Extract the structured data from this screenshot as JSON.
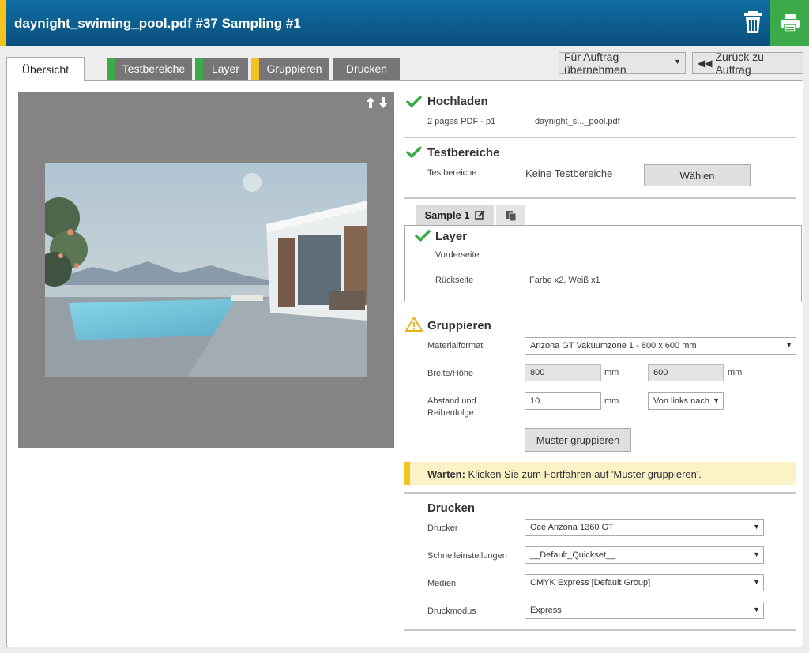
{
  "header": {
    "title": "daynight_swiming_pool.pdf #37 Sampling #1",
    "accent_color": "#f5c31b",
    "bar_color": "#0a5a8c",
    "print_color": "#3bab4a"
  },
  "tabs": [
    {
      "label": "Übersicht",
      "status": "active"
    },
    {
      "label": "Testbereiche",
      "status": "ok"
    },
    {
      "label": "Layer",
      "status": "ok"
    },
    {
      "label": "Gruppieren",
      "status": "warning"
    },
    {
      "label": "Drucken",
      "status": "none"
    }
  ],
  "toolbar": {
    "take_over_label": "Für Auftrag übernehmen",
    "back_label": "Zurück zu Auftrag"
  },
  "preview": {
    "arrows": "🡅🡇"
  },
  "upload": {
    "title": "Hochladen",
    "pages": "2 pages PDF - p1",
    "filename": "daynight_s..._pool.pdf"
  },
  "testareas": {
    "title": "Testbereiche",
    "label": "Testbereiche",
    "value": "Keine Testbereiche",
    "choose_label": "Wählen"
  },
  "sample": {
    "tab_label": "Sample 1",
    "layer_title": "Layer",
    "front_label": "Vorderseite",
    "back_label": "Rückseite",
    "back_value": "Farbe x2, Weiß x1"
  },
  "group": {
    "title": "Gruppieren",
    "material_label": "Materialformat",
    "material_value": "Arizona GT Vakuumzone 1 - 800 x 600 mm",
    "size_label": "Breite/Höhe",
    "width": "800",
    "height": "600",
    "unit": "mm",
    "spacing_label_1": "Abstand und",
    "spacing_label_2": "Reihenfolge",
    "spacing": "10",
    "order_value": "Von links nach",
    "group_button": "Muster gruppieren"
  },
  "warning": {
    "strong": "Warten:",
    "text": "Klicken Sie zum Fortfahren auf 'Muster gruppieren'."
  },
  "print": {
    "title": "Drucken",
    "printer_label": "Drucker",
    "printer_value": "Oce Arizona 1360 GT",
    "quickset_label": "Schnelleinstellungen",
    "quickset_value": "__Default_Quickset__",
    "media_label": "Medien",
    "media_value": "CMYK Express [Default Group]",
    "mode_label": "Druckmodus",
    "mode_value": "Express"
  }
}
